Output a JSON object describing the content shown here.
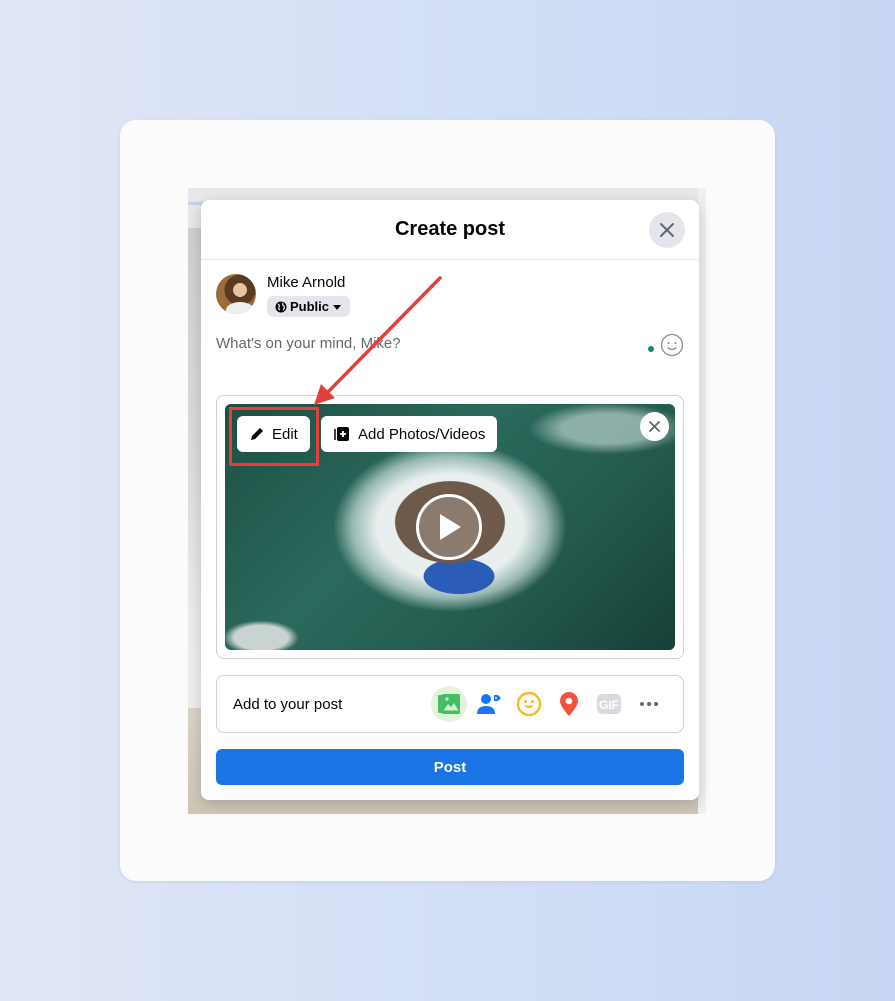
{
  "modal": {
    "title": "Create post",
    "close_icon": "close-icon"
  },
  "user": {
    "name": "Mike Arnold",
    "audience": "Public",
    "audience_icon": "globe-icon"
  },
  "composer": {
    "placeholder": "What's on your mind, Mike?",
    "emoji_icon": "smiley-icon"
  },
  "media": {
    "edit_label": "Edit",
    "add_label": "Add Photos/Videos",
    "play_icon": "play-icon",
    "remove_icon": "close-icon"
  },
  "add_to_post": {
    "label": "Add to your post",
    "icons": [
      "photo-video-icon",
      "tag-people-icon",
      "feeling-icon",
      "check-in-icon",
      "gif-icon",
      "more-icon"
    ],
    "gif_text": "GIF"
  },
  "post_button": {
    "label": "Post"
  },
  "annotation": {
    "color": "#e0413b",
    "target": "Edit"
  },
  "colors": {
    "primary": "#1b74e4",
    "highlight": "#e0413b",
    "photo_green": "#45bd62",
    "tag_blue": "#1877f2",
    "feeling_yellow": "#f7b928",
    "checkin_red": "#f5533d"
  }
}
